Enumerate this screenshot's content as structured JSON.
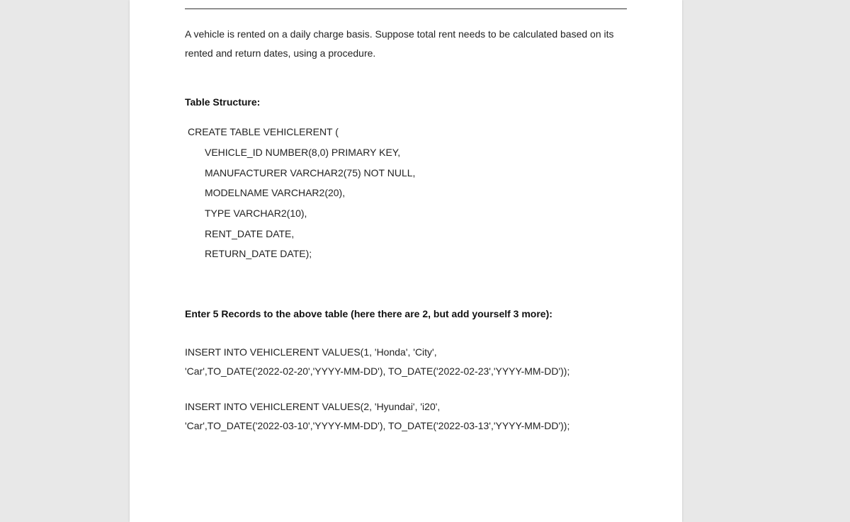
{
  "intro": "A vehicle is rented on a daily charge basis. Suppose total rent needs to be calculated based on its rented and return dates, using a procedure.",
  "tableStructureHeading": "Table Structure:",
  "createTable": {
    "open": "CREATE TABLE VEHICLERENT (",
    "cols": [
      "VEHICLE_ID NUMBER(8,0) PRIMARY KEY,",
      "MANUFACTURER VARCHAR2(75) NOT NULL,",
      "MODELNAME VARCHAR2(20),",
      "TYPE VARCHAR2(10),",
      "RENT_DATE DATE,",
      "RETURN_DATE DATE);"
    ]
  },
  "enterRecordsHeading": "Enter 5 Records to the above table (here there are 2, but add yourself 3 more):",
  "inserts": [
    {
      "l1": "INSERT INTO VEHICLERENT VALUES(1, 'Honda', 'City',",
      "l2": "'Car',TO_DATE('2022-02-20','YYYY-MM-DD'), TO_DATE('2022-02-23','YYYY-MM-DD'));"
    },
    {
      "l1": "INSERT INTO VEHICLERENT VALUES(2, 'Hyundai', 'i20',",
      "l2": "'Car',TO_DATE('2022-03-10','YYYY-MM-DD'), TO_DATE('2022-03-13','YYYY-MM-DD'));"
    }
  ]
}
